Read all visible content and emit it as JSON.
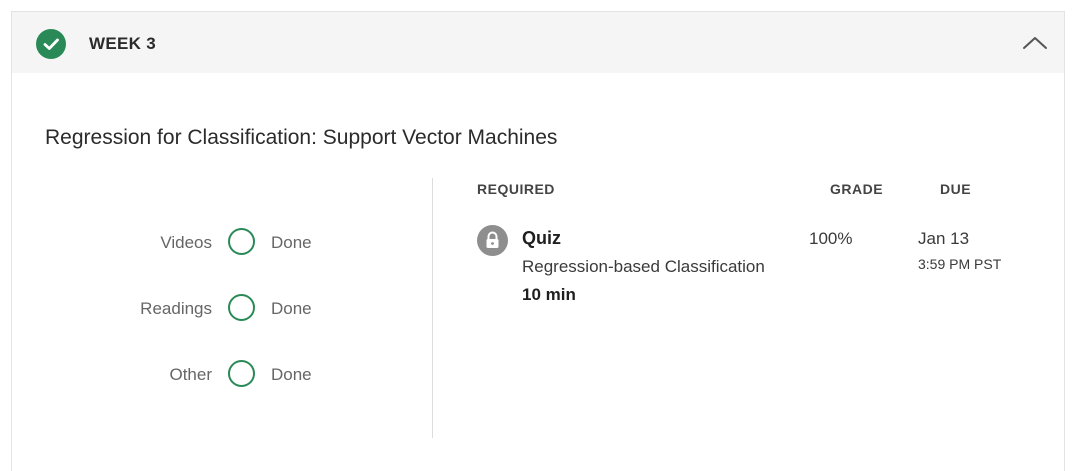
{
  "week": {
    "title": "WEEK 3",
    "status_icon": "check-circle-icon",
    "collapse_icon": "chevron-up-icon"
  },
  "module": {
    "title": "Regression for Classification: Support Vector Machines"
  },
  "summary": [
    {
      "label": "Videos",
      "status": "Done"
    },
    {
      "label": "Readings",
      "status": "Done"
    },
    {
      "label": "Other",
      "status": "Done"
    }
  ],
  "table": {
    "headers": {
      "required": "REQUIRED",
      "grade": "GRADE",
      "due": "DUE"
    },
    "items": [
      {
        "type": "Quiz",
        "name": "Regression-based Classification",
        "duration": "10 min",
        "grade": "100%",
        "due_date": "Jan 13",
        "due_time": "3:59 PM PST",
        "icon": "lock-icon"
      }
    ]
  },
  "colors": {
    "success_green": "#2a8a57",
    "header_bg": "#f5f5f5",
    "lock_gray": "#8e8e8e"
  }
}
